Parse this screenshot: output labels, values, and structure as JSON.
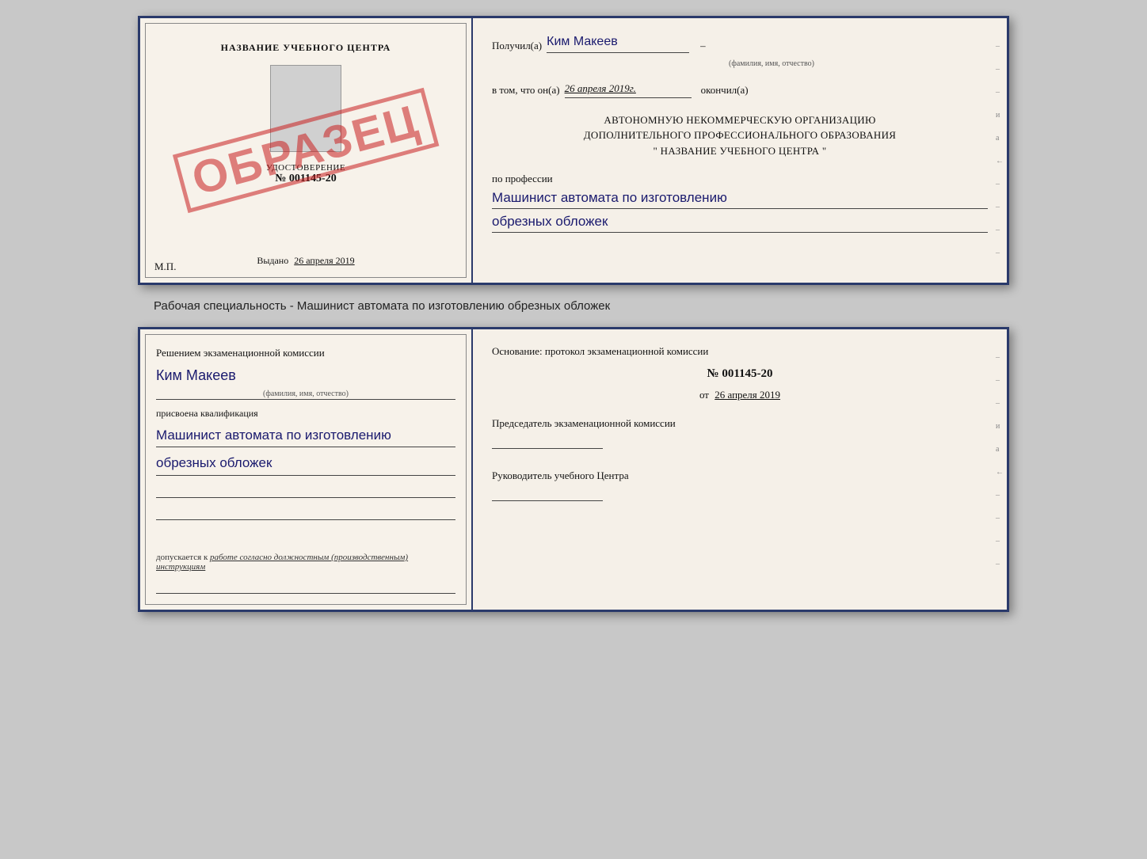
{
  "top_cert": {
    "left": {
      "title": "НАЗВАНИЕ УЧЕБНОГО ЦЕНТРА",
      "udostoverenie_label": "УДОСТОВЕРЕНИЕ",
      "number": "№ 001145-20",
      "vydano_label": "Выдано",
      "vydano_date": "26 апреля 2019",
      "mp_label": "М.П.",
      "stamp": "ОБРАЗЕЦ"
    },
    "right": {
      "poluchil_prefix": "Получил(а)",
      "recipient_name": "Ким Макеев",
      "fio_label": "(фамилия, имя, отчество)",
      "vtomchto_prefix": "в том, что он(а)",
      "date_value": "26 апреля 2019г.",
      "okonchil": "окончил(а)",
      "org_line1": "АВТОНОМНУЮ НЕКОММЕРЧЕСКУЮ ОРГАНИЗАЦИЮ",
      "org_line2": "ДОПОЛНИТЕЛЬНОГО ПРОФЕССИОНАЛЬНОГО ОБРАЗОВАНИЯ",
      "org_line3": "\"   НАЗВАНИЕ УЧЕБНОГО ЦЕНТРА   \"",
      "po_professii": "по профессии",
      "profession_line1": "Машинист автомата по изготовлению",
      "profession_line2": "обрезных обложек"
    }
  },
  "caption": {
    "text": "Рабочая специальность - Машинист автомата по изготовлению обрезных обложек"
  },
  "bottom_cert": {
    "left": {
      "resheniem_text": "Решением экзаменационной комиссии",
      "name": "Ким Макеев",
      "fio_label": "(фамилия, имя, отчество)",
      "prisvoena": "присвоена квалификация",
      "qualification_line1": "Машинист автомата по изготовлению",
      "qualification_line2": "обрезных обложек",
      "dopuskaetsya_text": "допускается к",
      "dopuskaetsya_italic": "работе согласно должностным (производственным) инструкциям"
    },
    "right": {
      "osnovanie_text": "Основание: протокол экзаменационной комиссии",
      "number": "№  001145-20",
      "ot_label": "от",
      "date_value": "26 апреля 2019",
      "predsedatel_label": "Председатель экзаменационной комиссии",
      "rukovoditel_label": "Руководитель учебного Центра"
    }
  },
  "side_marks": [
    "-",
    "-",
    "-",
    "и",
    "а",
    "←",
    "-",
    "-",
    "-",
    "-"
  ]
}
